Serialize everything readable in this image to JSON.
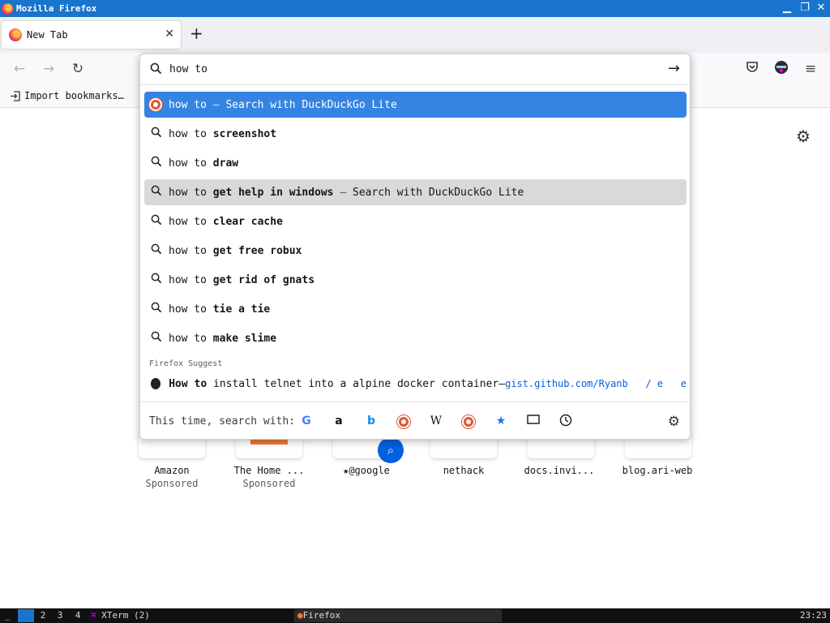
{
  "window": {
    "title": "Mozilla Firefox",
    "controls": [
      "minimize",
      "maximize",
      "close"
    ]
  },
  "tabs": [
    {
      "label": "New Tab",
      "active": true
    }
  ],
  "bookmarks": {
    "import_label": "Import bookmarks…"
  },
  "urlbar": {
    "value": "how to"
  },
  "suggestions": [
    {
      "prefix": "how to",
      "bold": "",
      "separator": " — ",
      "action": "Search with DuckDuckGo Lite",
      "icon": "duckduckgo-icon",
      "state": "selected"
    },
    {
      "prefix": "how to ",
      "bold": "screenshot",
      "separator": "",
      "action": "",
      "icon": "search-icon",
      "state": ""
    },
    {
      "prefix": "how to ",
      "bold": "draw",
      "separator": "",
      "action": "",
      "icon": "search-icon",
      "state": ""
    },
    {
      "prefix": "how to ",
      "bold": "get help in windows",
      "separator": " — ",
      "action": "Search with DuckDuckGo Lite",
      "icon": "search-icon",
      "state": "hovered"
    },
    {
      "prefix": "how to ",
      "bold": "clear cache",
      "separator": "",
      "action": "",
      "icon": "search-icon",
      "state": ""
    },
    {
      "prefix": "how to ",
      "bold": "get free robux",
      "separator": "",
      "action": "",
      "icon": "search-icon",
      "state": ""
    },
    {
      "prefix": "how to ",
      "bold": "get rid of gnats",
      "separator": "",
      "action": "",
      "icon": "search-icon",
      "state": ""
    },
    {
      "prefix": "how to ",
      "bold": "tie a tie",
      "separator": "",
      "action": "",
      "icon": "search-icon",
      "state": ""
    },
    {
      "prefix": "how to ",
      "bold": "make slime",
      "separator": "",
      "action": "",
      "icon": "search-icon",
      "state": ""
    }
  ],
  "firefox_suggest": {
    "label": "Firefox Suggest",
    "item": {
      "bold": "How to",
      "title": " install telnet into a alpine docker container",
      "separator": " — ",
      "url": "gist.github.com/Ryanb   / e   e"
    }
  },
  "engine_bar": {
    "lead": "This time, search with:",
    "engines": [
      "google-icon",
      "amazon-icon",
      "bing-icon",
      "duckduckgo-icon",
      "wikipedia-icon",
      "duckduckgo-lite-icon",
      "bookmarks-star-icon",
      "tabs-icon",
      "history-icon"
    ]
  },
  "top_sites": [
    {
      "label": "Amazon",
      "sub": "Sponsored"
    },
    {
      "label": "The Home ...",
      "sub": "Sponsored"
    },
    {
      "label": "★@google",
      "sub": ""
    },
    {
      "label": "nethack",
      "sub": ""
    },
    {
      "label": "docs.invi...",
      "sub": ""
    },
    {
      "label": "blog.ari-web",
      "sub": ""
    }
  ],
  "taskbar": {
    "workspaces": [
      "1",
      "2",
      "3",
      "4"
    ],
    "tasks": [
      "XTerm (2)",
      "Firefox"
    ],
    "clock": "23:23"
  },
  "colors": {
    "accent": "#3584e4",
    "titlebar": "#1874cd",
    "hover": "#d9d9d9"
  }
}
